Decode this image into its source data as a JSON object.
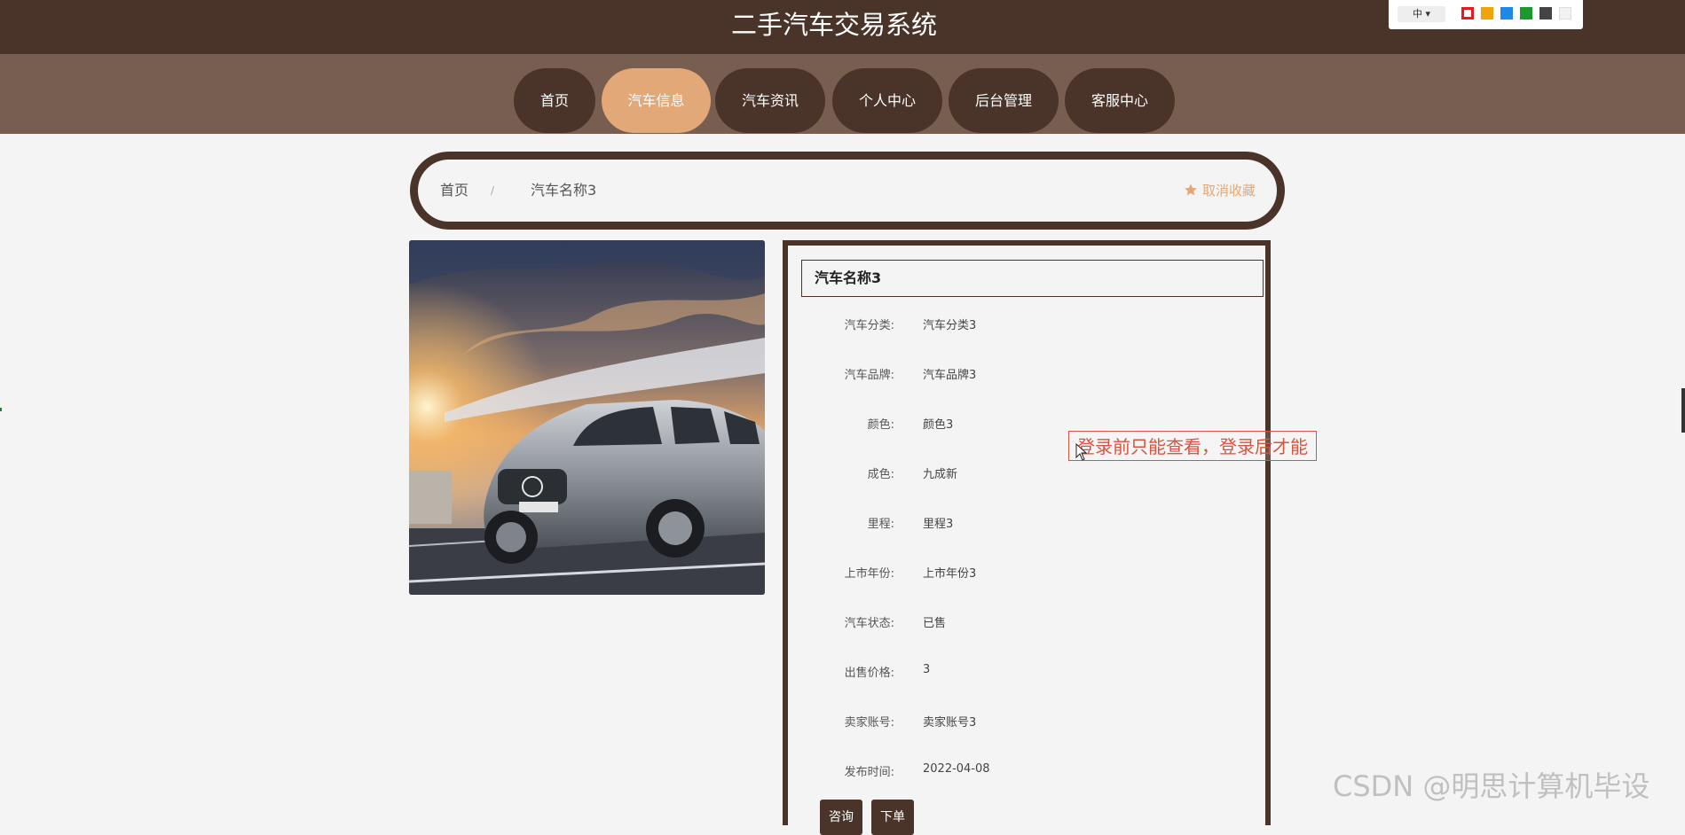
{
  "header": {
    "site_title": "二手汽车交易系统"
  },
  "theme_panel": {
    "language": "中",
    "language_caret": "▾",
    "swatches": [
      "#e41c1c",
      "#f0a30a",
      "#1e88e5",
      "#1a9a2a",
      "#444444",
      "#f2f2f2"
    ]
  },
  "nav": {
    "items": [
      {
        "label": "首页"
      },
      {
        "label": "汽车信息",
        "active": true
      },
      {
        "label": "汽车资讯"
      },
      {
        "label": "个人中心"
      },
      {
        "label": "后台管理"
      },
      {
        "label": "客服中心"
      }
    ]
  },
  "breadcrumb": {
    "home": "首页",
    "separator": "/",
    "current": "汽车名称3",
    "favorite_label": "取消收藏",
    "favorite_icon": "star-icon"
  },
  "detail": {
    "title": "汽车名称3",
    "rows": [
      {
        "label": "汽车分类:",
        "value": "汽车分类3"
      },
      {
        "label": "汽车品牌:",
        "value": "汽车品牌3"
      },
      {
        "label": "颜色:",
        "value": "颜色3"
      },
      {
        "label": "成色:",
        "value": "九成新"
      },
      {
        "label": "里程:",
        "value": "里程3"
      },
      {
        "label": "上市年份:",
        "value": "上市年份3"
      },
      {
        "label": "汽车状态:",
        "value": "已售"
      },
      {
        "label": "出售价格:",
        "value": "3"
      },
      {
        "label": "卖家账号:",
        "value": "卖家账号3"
      },
      {
        "label": "发布时间:",
        "value": "2022-04-08"
      }
    ],
    "buttons": {
      "consult": "咨询",
      "order": "下单"
    }
  },
  "overlay_note": "登录前只能查看，登录后才能",
  "watermark": "CSDN @明思计算机毕设",
  "colors": {
    "primary": "#4a3429",
    "nav_bg": "#785d51",
    "accent": "#e3a878",
    "note": "#d9543f"
  }
}
